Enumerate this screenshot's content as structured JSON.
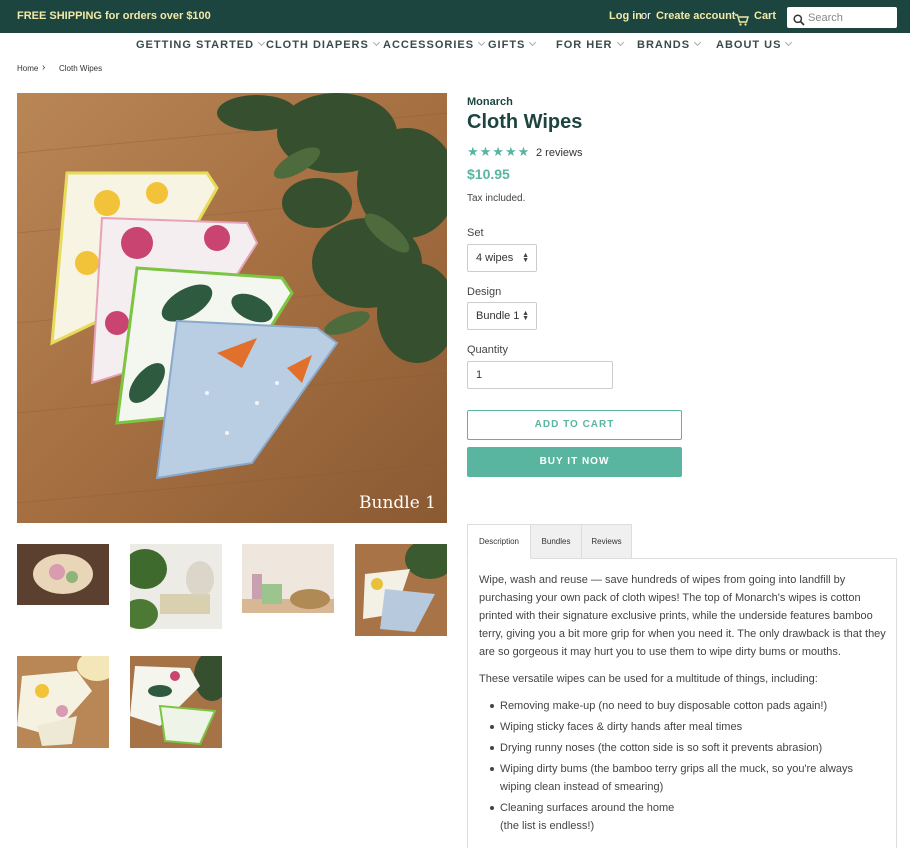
{
  "topbar": {
    "promo": "FREE SHIPPING for orders over $100",
    "login": "Log in",
    "or": "or",
    "create_account": "Create account",
    "cart": "Cart",
    "search_placeholder": "Search",
    "icons": [
      "cart-icon",
      "search-icon"
    ]
  },
  "nav": [
    "GETTING STARTED",
    "CLOTH DIAPERS",
    "ACCESSORIES",
    "GIFTS",
    "FOR HER",
    "BRANDS",
    "ABOUT US"
  ],
  "breadcrumb": {
    "home": "Home",
    "sep": "›",
    "current": "Cloth Wipes"
  },
  "hero": {
    "caption": "Bundle 1"
  },
  "product": {
    "vendor": "Monarch",
    "title": "Cloth Wipes",
    "stars": "★★★★★",
    "rating": 5,
    "reviews": "2 reviews",
    "price": "$10.95",
    "tax": "Tax included.",
    "set_label": "Set",
    "set_value": "4 wipes",
    "design_label": "Design",
    "design_value": "Bundle 1",
    "quantity_label": "Quantity",
    "quantity_value": "1",
    "add_to_cart": "ADD TO CART",
    "buy_now": "BUY IT NOW"
  },
  "tabs": [
    "Description",
    "Bundles",
    "Reviews"
  ],
  "description": {
    "para1": "Wipe, wash and reuse — save hundreds of wipes from going into landfill by purchasing your own pack of cloth wipes! The top of Monarch's wipes is cotton printed with their signature exclusive prints, while the underside features bamboo terry, giving you a bit more grip for when you need it. The only drawback is that they are so gorgeous it may hurt you to use them to wipe dirty bums or mouths.",
    "para2": "These versatile wipes can be used for a multitude of things, including:",
    "items": [
      "Removing make-up (no need to buy disposable cotton pads again!)",
      "Wiping sticky faces & dirty hands after meal times",
      "Drying runny noses (the cotton side is so soft it prevents abrasion)",
      "Wiping dirty bums (the bamboo terry grips all the muck, so you're always wiping clean instead of smearing)",
      "Cleaning surfaces around the home",
      "(the list is endless!)"
    ]
  },
  "colors": {
    "topbar": "#1d4540",
    "promo": "#f2e9a6",
    "accent": "#5ab5a0",
    "heading": "#1d4540"
  }
}
